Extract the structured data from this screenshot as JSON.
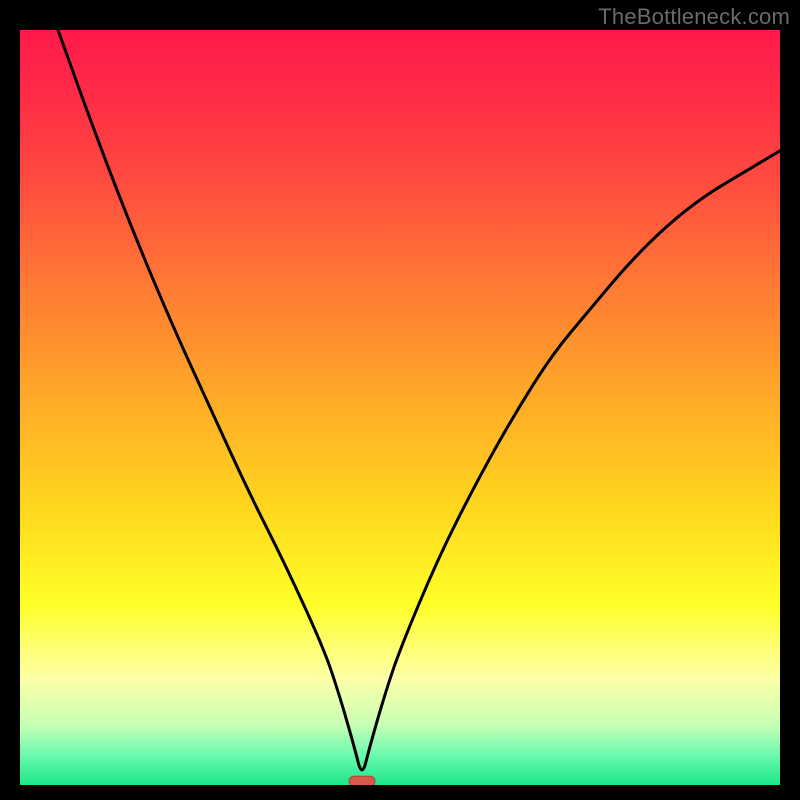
{
  "watermark": "TheBottleneck.com",
  "chart_data": {
    "type": "line",
    "title": "",
    "xlabel": "",
    "ylabel": "",
    "xlim": [
      0,
      100
    ],
    "ylim": [
      0,
      100
    ],
    "grid": false,
    "legend": false,
    "series": [
      {
        "name": "curve",
        "x": [
          5,
          10,
          15,
          20,
          25,
          30,
          35,
          40,
          42,
          44,
          45,
          46,
          48,
          50,
          55,
          60,
          65,
          70,
          75,
          80,
          85,
          90,
          95,
          100
        ],
        "y": [
          100,
          86,
          73,
          61,
          50,
          39,
          29,
          18,
          12,
          5,
          1,
          5,
          12,
          18,
          30,
          40,
          49,
          57,
          63,
          69,
          74,
          78,
          81,
          84
        ]
      }
    ],
    "marker": {
      "x": 45,
      "y": 0.5,
      "color": "#d85a4f"
    },
    "gradient_stops": [
      {
        "pos": 0,
        "color": "#ff1a4b"
      },
      {
        "pos": 20,
        "color": "#ff4b3f"
      },
      {
        "pos": 50,
        "color": "#ffae27"
      },
      {
        "pos": 76,
        "color": "#ffff28"
      },
      {
        "pos": 92,
        "color": "#c7ffb4"
      },
      {
        "pos": 100,
        "color": "#1ce789"
      }
    ]
  }
}
